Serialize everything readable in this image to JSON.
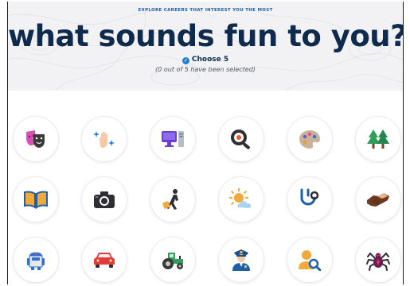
{
  "header": {
    "eyebrow": "EXPLORE CAREERS THAT INTEREST YOU THE MOST",
    "title": "what sounds fun to you?",
    "choose_label": "Choose 5",
    "selection_status": "(0 out of 5 have been selected)"
  },
  "interests": [
    {
      "icon": "theater-masks-icon"
    },
    {
      "icon": "sparkle-hand-icon"
    },
    {
      "icon": "computer-icon"
    },
    {
      "icon": "frying-pan-icon"
    },
    {
      "icon": "paint-palette-icon"
    },
    {
      "icon": "trees-icon"
    },
    {
      "icon": "open-book-icon"
    },
    {
      "icon": "camera-icon"
    },
    {
      "icon": "traveler-icon"
    },
    {
      "icon": "sun-cloud-icon"
    },
    {
      "icon": "stethoscope-icon"
    },
    {
      "icon": "handshake-icon"
    },
    {
      "icon": "robot-icon"
    },
    {
      "icon": "car-icon"
    },
    {
      "icon": "tractor-icon"
    },
    {
      "icon": "police-officer-icon"
    },
    {
      "icon": "person-search-icon"
    },
    {
      "icon": "spider-icon"
    }
  ],
  "colors": {
    "title": "#0e2a4d",
    "accent": "#1d7fd6",
    "header_bg": "#f2f2f4"
  }
}
